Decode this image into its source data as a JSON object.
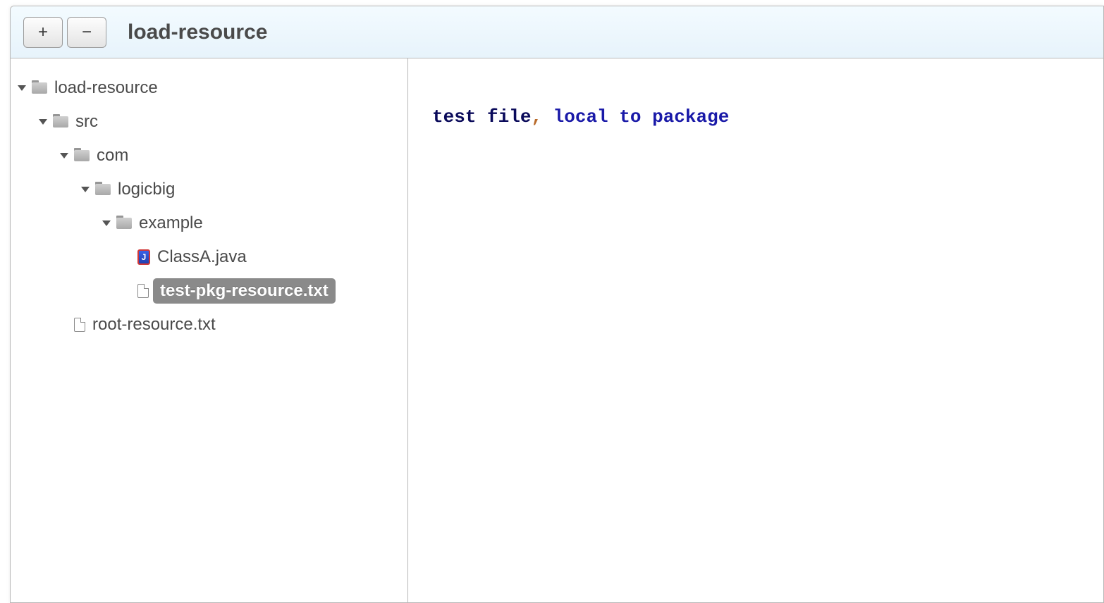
{
  "toolbar": {
    "expand_label": "+",
    "collapse_label": "−",
    "title": "load-resource"
  },
  "tree": {
    "n0": "load-resource",
    "n1": "src",
    "n2": "com",
    "n3": "logicbig",
    "n4": "example",
    "n5": "ClassA.java",
    "n6": "test-pkg-resource.txt",
    "n7": "root-resource.txt",
    "java_badge": "J"
  },
  "editor": {
    "seg1": "test file",
    "seg2": ",",
    "seg3": " local to package"
  }
}
